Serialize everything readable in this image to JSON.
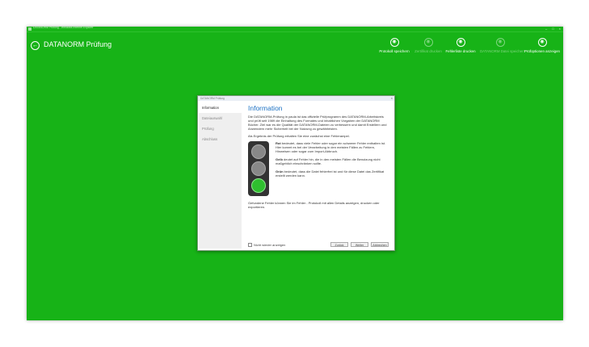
{
  "titlebar": {
    "text": "DATANORM Prüfung - Windows Internet Explorer"
  },
  "header": {
    "back_icon": "arrow-left-icon",
    "title": "DATANORM Prüfung"
  },
  "toolbar": {
    "items": [
      {
        "label": "Protokoll speichern",
        "icon": "save-icon",
        "enabled": true
      },
      {
        "label": "Zertifikat drucken",
        "icon": "certificate-icon",
        "enabled": false
      },
      {
        "label": "Fehlerliste drucken",
        "icon": "print-icon",
        "enabled": true
      },
      {
        "label": "DATANORM Datei speichern",
        "icon": "save-icon",
        "enabled": false
      },
      {
        "label": "Prüfoptionen anzeigen",
        "icon": "options-icon",
        "enabled": true
      }
    ]
  },
  "dialog": {
    "title": "DATANORM Prüfung",
    "steps": [
      "Information",
      "Dateiauswahl",
      "Prüfung",
      "Abschluss"
    ],
    "heading": "Information",
    "intro": "Die DATANORM-Prüfung in paula ist das offizielle Prüfprogramm des DATANORM-Arbeitskreis und prüft seit 1989 die Einhaltung des Formates und inhaltlichen Vorgaben der DATANORM Bücher. Ziel war es die Qualität der DATANORM-Dateien zu verbessern und damit Erstellern und Anwendern mehr Sicherheit bei der Nutzung zu gewährleisten.",
    "result_intro": "Als Ergebnis der Prüfung erhalten Sie eine zunächst eine Fehlerampel.",
    "red_bold": "Rot",
    "red_text": " bedeutet, dass viele Fehler oder sogar ein schwerer Fehler enthalten ist. Hier kommt es bei der Verarbeitung in den meisten Fällen zu Fehlern, Hinweisen oder sogar zum Import-Abbruch.",
    "yellow_bold": "Gelb",
    "yellow_text": " deutet auf Fehler hin, die in den meisten Fällen die Benutzung nicht maßgeblich einschränken sollte.",
    "green_bold": "Grün",
    "green_text": " bedeutet, dass die Datei fehlerfrei ist und für diese Datei das Zertifikat erstellt werden kann.",
    "outro": "Gefundene Fehler können Sie im Fehler - Protokoll mit allen Details anzeigen, drucken oder exportieren.",
    "checkbox_label": "Nicht wieder anzeigen",
    "buttons": {
      "back": "Zurück",
      "next": "Weiter",
      "cancel": "Abbrechen"
    },
    "traffic_light_active": "green"
  },
  "colors": {
    "app_bg": "#17b317",
    "heading": "#1f73c4",
    "light_on": "#2fbf2f"
  }
}
